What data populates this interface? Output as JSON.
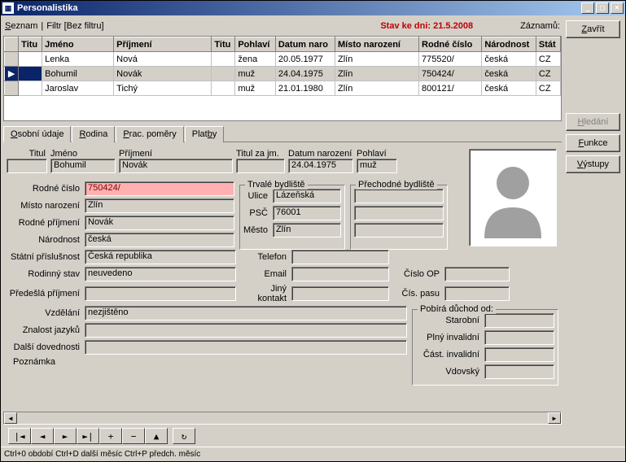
{
  "window": {
    "title": "Personalistika"
  },
  "toprow": {
    "seznam": "Seznam",
    "filtr": "Filtr [Bez filtru]",
    "status": "Stav ke dni: 21.5.2008",
    "zaznamu": "Záznamů:"
  },
  "buttons": {
    "zavrit": "Zavřít",
    "hledat": "Hledání",
    "funkce": "Funkce",
    "vystupy": "Výstupy"
  },
  "gridCols": {
    "titul": "Titu",
    "jmeno": "Jméno",
    "prijmeni": "Příjmení",
    "tit2": "Titu",
    "pohlavi": "Pohlaví",
    "datnar": "Datum naro",
    "mistonar": "Místo narození",
    "rc": "Rodné číslo",
    "narodnost": "Národnost",
    "stat": "Stát"
  },
  "rows": [
    {
      "titul": "",
      "jmeno": "Lenka",
      "prijmeni": "Nová",
      "tit2": "",
      "pohlavi": "žena",
      "datnar": "20.05.1977",
      "mistonar": "Zlín",
      "rc": "775520/",
      "narodnost": "česká",
      "stat": "CZ"
    },
    {
      "titul": "",
      "jmeno": "Bohumil",
      "prijmeni": "Novák",
      "tit2": "",
      "pohlavi": "muž",
      "datnar": "24.04.1975",
      "mistonar": "Zlín",
      "rc": "750424/",
      "narodnost": "česká",
      "stat": "CZ"
    },
    {
      "titul": "",
      "jmeno": "Jaroslav",
      "prijmeni": "Tichý",
      "tit2": "",
      "pohlavi": "muž",
      "datnar": "21.01.1980",
      "mistonar": "Zlín",
      "rc": "800121/",
      "narodnost": "česká",
      "stat": "CZ"
    }
  ],
  "selectedRow": 1,
  "tabs": {
    "osobni": "Osobní údaje",
    "rodina": "Rodina",
    "pomery": "Prac. poměry",
    "platby": "Platby"
  },
  "labels": {
    "titul": "Titul",
    "jmeno": "Jméno",
    "prijmeni": "Příjmení",
    "titulza": "Titul za jm.",
    "datnar": "Datum narození",
    "pohlavi": "Pohlaví",
    "rc": "Rodné číslo",
    "mistonar": "Místo narození",
    "rodprij": "Rodné příjmení",
    "narodnost": "Národnost",
    "statprisl": "Státní příslušnost",
    "rodstav": "Rodinný stav",
    "predprij": "Předešlá příjmení",
    "vzdelani": "Vzdělání",
    "znjaz": "Znalost jazyků",
    "dalsidov": "Další dovednosti",
    "poznamka": "Poznámka",
    "trvbyd": "Trvalé bydliště",
    "prechbyd": "Přechodné bydliště",
    "ulice": "Ulice",
    "psc": "PSČ",
    "mesto": "Město",
    "telefon": "Telefon",
    "email": "Email",
    "jinyk": "Jiný kontakt",
    "cop": "Číslo OP",
    "cpasu": "Čís. pasu",
    "duchod": "Pobírá důchod od:",
    "starob": "Starobní",
    "plnyinv": "Plný invalidní",
    "castinv": "Část. invalidní",
    "vdov": "Vdovský"
  },
  "values": {
    "titul": "",
    "jmeno": "Bohumil",
    "prijmeni": "Novák",
    "titulza": "",
    "datnar": "24.04.1975",
    "pohlavi": "muž",
    "rc": "750424/",
    "mistonar": "Zlín",
    "rodprij": "Novák",
    "narodnost": "česká",
    "statprisl": "Česká republika",
    "rodstav": "neuvedeno",
    "predprij": "",
    "vzdelani": "nezjištěno",
    "znjaz": "",
    "dalsidov": "",
    "poznamka": "",
    "ulice": "Lázeňská",
    "psc": "76001",
    "mesto": "Zlín",
    "ulice2": "",
    "psc2": "",
    "mesto2": "",
    "telefon": "",
    "email": "",
    "jinyk": "",
    "cop": "",
    "cpasu": "",
    "starob": "",
    "plnyinv": "",
    "castinv": "",
    "vdov": ""
  },
  "statusbar": "Ctrl+0 období  Ctrl+D další měsíc  Ctrl+P předch. měsíc"
}
